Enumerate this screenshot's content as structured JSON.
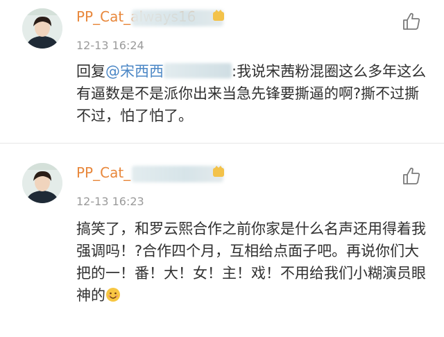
{
  "comments": [
    {
      "username": "PP_Cat_always16",
      "timestamp": "12-13 16:24",
      "reply_prefix": "回复",
      "mention": "@宋西西",
      "body": ":我说宋茜粉混圈这么多年这么有逼数是不是派你出来当急先锋要撕逼的啊?撕不过撕不过，怕了怕了。"
    },
    {
      "username": "PP_Cat_",
      "timestamp": "12-13 16:23",
      "body": "搞笑了，和罗云熙合作之前你家是什么名声还用得着我强调吗！?合作四个月，互相给点面子吧。再说你们大把的一！番！大！女！主！戏！不用给我们小糊演员眼神的"
    }
  ],
  "icons": {
    "like": "thumbs-up-icon",
    "badge": "vip-badge-icon",
    "emoji": "smiling-face-emoji-icon"
  },
  "colors": {
    "username": "#e8873b",
    "mention": "#4a86c5",
    "timestamp": "#9a9a9a"
  }
}
